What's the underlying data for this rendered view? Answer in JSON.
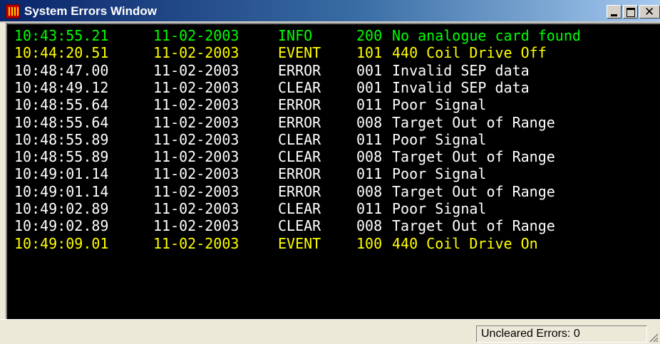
{
  "window": {
    "title": "System Errors Window",
    "controls": {
      "minimize": "minimize-icon",
      "maximize": "maximize-icon",
      "close": "close-icon"
    }
  },
  "colors": {
    "console_bg": "#000000",
    "INFO": "#00ff00",
    "EVENT": "#ffff00",
    "ERROR": "#ffffff",
    "CLEAR": "#ffffff"
  },
  "log": [
    {
      "time": "10:43:55.21",
      "date": "11-02-2003",
      "type": "INFO",
      "code": "200",
      "message": "No analogue card found"
    },
    {
      "time": "10:44:20.51",
      "date": "11-02-2003",
      "type": "EVENT",
      "code": "101",
      "message": "440 Coil Drive Off"
    },
    {
      "time": "10:48:47.00",
      "date": "11-02-2003",
      "type": "ERROR",
      "code": "001",
      "message": "Invalid SEP data"
    },
    {
      "time": "10:48:49.12",
      "date": "11-02-2003",
      "type": "CLEAR",
      "code": "001",
      "message": "Invalid SEP data"
    },
    {
      "time": "10:48:55.64",
      "date": "11-02-2003",
      "type": "ERROR",
      "code": "011",
      "message": "Poor Signal"
    },
    {
      "time": "10:48:55.64",
      "date": "11-02-2003",
      "type": "ERROR",
      "code": "008",
      "message": "Target Out of Range"
    },
    {
      "time": "10:48:55.89",
      "date": "11-02-2003",
      "type": "CLEAR",
      "code": "011",
      "message": "Poor Signal"
    },
    {
      "time": "10:48:55.89",
      "date": "11-02-2003",
      "type": "CLEAR",
      "code": "008",
      "message": "Target Out of Range"
    },
    {
      "time": "10:49:01.14",
      "date": "11-02-2003",
      "type": "ERROR",
      "code": "011",
      "message": "Poor Signal"
    },
    {
      "time": "10:49:01.14",
      "date": "11-02-2003",
      "type": "ERROR",
      "code": "008",
      "message": "Target Out of Range"
    },
    {
      "time": "10:49:02.89",
      "date": "11-02-2003",
      "type": "CLEAR",
      "code": "011",
      "message": "Poor Signal"
    },
    {
      "time": "10:49:02.89",
      "date": "11-02-2003",
      "type": "CLEAR",
      "code": "008",
      "message": "Target Out of Range"
    },
    {
      "time": "10:49:09.01",
      "date": "11-02-2003",
      "type": "EVENT",
      "code": "100",
      "message": "440 Coil Drive On"
    }
  ],
  "status": {
    "uncleared_errors": "Uncleared Errors: 0"
  }
}
